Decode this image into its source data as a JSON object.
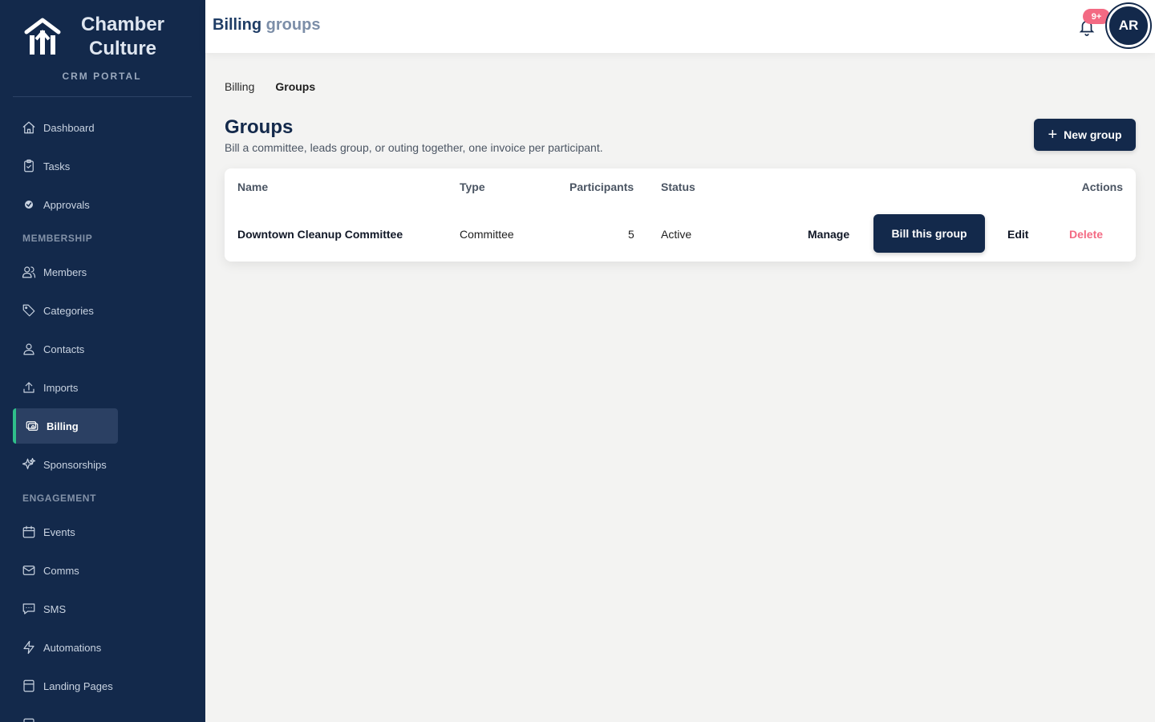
{
  "brand": {
    "name_line1": "Chamber",
    "name_line2": "Culture",
    "subtitle": "CRM PORTAL"
  },
  "sidebar": {
    "items": [
      {
        "label": "Dashboard",
        "icon": "home-icon"
      },
      {
        "label": "Tasks",
        "icon": "clipboard-check-icon"
      },
      {
        "label": "Approvals",
        "icon": "check-circle-icon"
      },
      {
        "label": "Members",
        "icon": "users-icon"
      },
      {
        "label": "Categories",
        "icon": "tag-icon"
      },
      {
        "label": "Contacts",
        "icon": "user-icon"
      },
      {
        "label": "Imports",
        "icon": "upload-icon"
      },
      {
        "label": "Billing",
        "icon": "billing-icon",
        "active": true
      },
      {
        "label": "Sponsorships",
        "icon": "sparkles-icon"
      },
      {
        "label": "Events",
        "icon": "calendar-icon"
      },
      {
        "label": "Comms",
        "icon": "mail-icon"
      },
      {
        "label": "SMS",
        "icon": "chat-icon"
      },
      {
        "label": "Automations",
        "icon": "bolt-icon"
      },
      {
        "label": "Landing Pages",
        "icon": "layout-icon"
      }
    ],
    "sections": {
      "membership": "MEMBERSHIP",
      "engagement": "ENGAGEMENT"
    }
  },
  "header": {
    "title_part1": "Billing",
    "title_part2": "groups",
    "notification_badge": "9+",
    "avatar_initials": "AR"
  },
  "breadcrumb": {
    "parent": "Billing",
    "current": "Groups"
  },
  "section": {
    "title": "Groups",
    "description": "Bill a committee, leads group, or outing together, one invoice per participant.",
    "new_button": "New group"
  },
  "table": {
    "headers": {
      "name": "Name",
      "type": "Type",
      "participants": "Participants",
      "status": "Status",
      "actions": "Actions"
    },
    "rows": [
      {
        "name": "Downtown Cleanup Committee",
        "type": "Committee",
        "participants": "5",
        "status": "Active",
        "manage": "Manage",
        "bill": "Bill this group",
        "edit": "Edit",
        "delete": "Delete"
      }
    ]
  },
  "colors": {
    "sidebar": "#13294b",
    "accent": "#2fbf8a",
    "danger": "#f36a83",
    "badge": "#f36a83"
  }
}
